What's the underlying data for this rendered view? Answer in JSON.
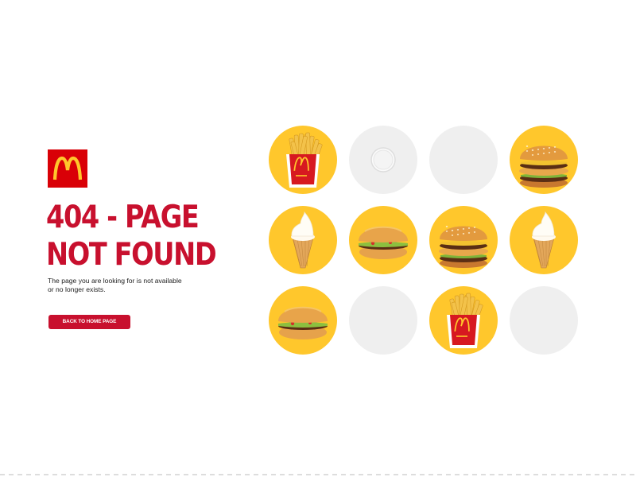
{
  "brand": {
    "logo_icon": "mcdonalds-arches-logo",
    "color": "#c8102e",
    "logo_bg": "#d90007"
  },
  "error": {
    "title_line1": "404 - PAGE",
    "title_line2": "NOT FOUND",
    "message_line1": "The page you are looking for is not available",
    "message_line2": "or no longer exists."
  },
  "actions": {
    "home_label": "BACK TO HOME PAGE"
  },
  "colors": {
    "tile_yellow": "#ffc72c",
    "tile_grey": "#efefef"
  },
  "grid": {
    "tiles": [
      {
        "item": "fries-icon",
        "state": "yellow"
      },
      {
        "item": "loading-spinner-icon",
        "state": "grey"
      },
      {
        "item": "empty",
        "state": "grey"
      },
      {
        "item": "big-mac-icon",
        "state": "yellow"
      },
      {
        "item": "ice-cream-cone-icon",
        "state": "yellow"
      },
      {
        "item": "hamburger-icon",
        "state": "yellow"
      },
      {
        "item": "big-mac-icon",
        "state": "yellow"
      },
      {
        "item": "ice-cream-cone-icon",
        "state": "yellow"
      },
      {
        "item": "hamburger-icon",
        "state": "yellow"
      },
      {
        "item": "empty",
        "state": "grey"
      },
      {
        "item": "fries-icon",
        "state": "yellow"
      },
      {
        "item": "empty",
        "state": "grey"
      }
    ]
  }
}
